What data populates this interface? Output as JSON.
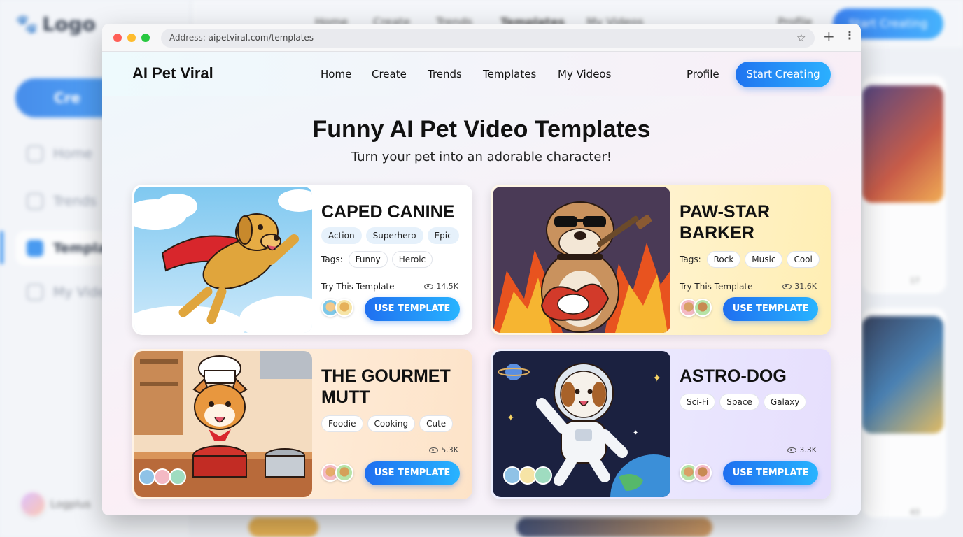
{
  "background": {
    "logo": "Logo",
    "create_label": "Cre",
    "nav": [
      {
        "label": "Home",
        "icon": "home-icon"
      },
      {
        "label": "Trends",
        "icon": "trends-icon"
      },
      {
        "label": "Templa",
        "icon": "templates-icon"
      },
      {
        "label": "My Vide",
        "icon": "user-icon"
      }
    ],
    "user_label": "Logplus",
    "top_links": [
      "Home",
      "Create",
      "Trends",
      "Templates",
      "My Videos",
      "Profile"
    ],
    "start_label": "Start Creating",
    "blur_counts": [
      "17",
      "43"
    ]
  },
  "browser": {
    "address_label": "Address:",
    "url": "aipetviral.com/templates",
    "star_icon": "star-icon",
    "new_tab_icon": "plus-icon",
    "menu_icon": "kebab-icon"
  },
  "site": {
    "brand": "AI Pet Viral",
    "nav": [
      "Home",
      "Create",
      "Trends",
      "Templates",
      "My Videos"
    ],
    "profile": "Profile",
    "start": "Start Creating",
    "title": "Funny AI Pet Video Templates",
    "subtitle": "Turn your pet into an adorable character!",
    "tags_label": "Tags:",
    "try_label": "Try This Template",
    "use_label": "USE TEMPLATE",
    "cards": [
      {
        "title": "CAPED CANINE",
        "categories": [
          "Action",
          "Superhero",
          "Epic"
        ],
        "tags": [
          "Funny",
          "Heroic"
        ],
        "views": "14.5K"
      },
      {
        "title": "PAW-STAR BARKER",
        "categories": [],
        "tags": [
          "Rock",
          "Music",
          "Cool"
        ],
        "views": "31.6K"
      },
      {
        "title": "THE GOURMET MUTT",
        "categories": [
          "Foodie",
          "Cooking",
          "Cute"
        ],
        "tags": [],
        "views": "5.3K"
      },
      {
        "title": "ASTRO-DOG",
        "categories": [
          "Sci-Fi",
          "Space",
          "Galaxy"
        ],
        "tags": [],
        "views": "3.3K"
      }
    ]
  },
  "colors": {
    "accent": "#1f74f0",
    "accent_light": "#2bb0ff"
  }
}
